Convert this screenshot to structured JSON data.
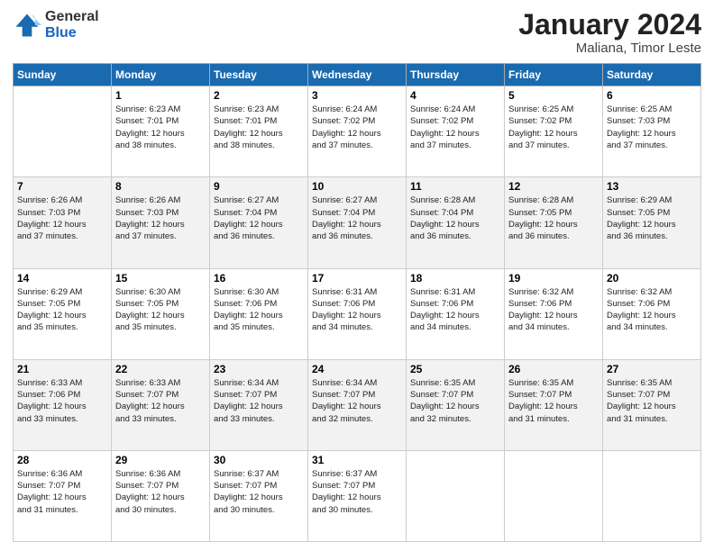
{
  "header": {
    "logo_general": "General",
    "logo_blue": "Blue",
    "main_title": "January 2024",
    "subtitle": "Maliana, Timor Leste"
  },
  "days_of_week": [
    "Sunday",
    "Monday",
    "Tuesday",
    "Wednesday",
    "Thursday",
    "Friday",
    "Saturday"
  ],
  "weeks": [
    {
      "bg": "white",
      "days": [
        {
          "num": "",
          "info": ""
        },
        {
          "num": "1",
          "info": "Sunrise: 6:23 AM\nSunset: 7:01 PM\nDaylight: 12 hours\nand 38 minutes."
        },
        {
          "num": "2",
          "info": "Sunrise: 6:23 AM\nSunset: 7:01 PM\nDaylight: 12 hours\nand 38 minutes."
        },
        {
          "num": "3",
          "info": "Sunrise: 6:24 AM\nSunset: 7:02 PM\nDaylight: 12 hours\nand 37 minutes."
        },
        {
          "num": "4",
          "info": "Sunrise: 6:24 AM\nSunset: 7:02 PM\nDaylight: 12 hours\nand 37 minutes."
        },
        {
          "num": "5",
          "info": "Sunrise: 6:25 AM\nSunset: 7:02 PM\nDaylight: 12 hours\nand 37 minutes."
        },
        {
          "num": "6",
          "info": "Sunrise: 6:25 AM\nSunset: 7:03 PM\nDaylight: 12 hours\nand 37 minutes."
        }
      ]
    },
    {
      "bg": "gray",
      "days": [
        {
          "num": "7",
          "info": "Sunrise: 6:26 AM\nSunset: 7:03 PM\nDaylight: 12 hours\nand 37 minutes."
        },
        {
          "num": "8",
          "info": "Sunrise: 6:26 AM\nSunset: 7:03 PM\nDaylight: 12 hours\nand 37 minutes."
        },
        {
          "num": "9",
          "info": "Sunrise: 6:27 AM\nSunset: 7:04 PM\nDaylight: 12 hours\nand 36 minutes."
        },
        {
          "num": "10",
          "info": "Sunrise: 6:27 AM\nSunset: 7:04 PM\nDaylight: 12 hours\nand 36 minutes."
        },
        {
          "num": "11",
          "info": "Sunrise: 6:28 AM\nSunset: 7:04 PM\nDaylight: 12 hours\nand 36 minutes."
        },
        {
          "num": "12",
          "info": "Sunrise: 6:28 AM\nSunset: 7:05 PM\nDaylight: 12 hours\nand 36 minutes."
        },
        {
          "num": "13",
          "info": "Sunrise: 6:29 AM\nSunset: 7:05 PM\nDaylight: 12 hours\nand 36 minutes."
        }
      ]
    },
    {
      "bg": "white",
      "days": [
        {
          "num": "14",
          "info": "Sunrise: 6:29 AM\nSunset: 7:05 PM\nDaylight: 12 hours\nand 35 minutes."
        },
        {
          "num": "15",
          "info": "Sunrise: 6:30 AM\nSunset: 7:05 PM\nDaylight: 12 hours\nand 35 minutes."
        },
        {
          "num": "16",
          "info": "Sunrise: 6:30 AM\nSunset: 7:06 PM\nDaylight: 12 hours\nand 35 minutes."
        },
        {
          "num": "17",
          "info": "Sunrise: 6:31 AM\nSunset: 7:06 PM\nDaylight: 12 hours\nand 34 minutes."
        },
        {
          "num": "18",
          "info": "Sunrise: 6:31 AM\nSunset: 7:06 PM\nDaylight: 12 hours\nand 34 minutes."
        },
        {
          "num": "19",
          "info": "Sunrise: 6:32 AM\nSunset: 7:06 PM\nDaylight: 12 hours\nand 34 minutes."
        },
        {
          "num": "20",
          "info": "Sunrise: 6:32 AM\nSunset: 7:06 PM\nDaylight: 12 hours\nand 34 minutes."
        }
      ]
    },
    {
      "bg": "gray",
      "days": [
        {
          "num": "21",
          "info": "Sunrise: 6:33 AM\nSunset: 7:06 PM\nDaylight: 12 hours\nand 33 minutes."
        },
        {
          "num": "22",
          "info": "Sunrise: 6:33 AM\nSunset: 7:07 PM\nDaylight: 12 hours\nand 33 minutes."
        },
        {
          "num": "23",
          "info": "Sunrise: 6:34 AM\nSunset: 7:07 PM\nDaylight: 12 hours\nand 33 minutes."
        },
        {
          "num": "24",
          "info": "Sunrise: 6:34 AM\nSunset: 7:07 PM\nDaylight: 12 hours\nand 32 minutes."
        },
        {
          "num": "25",
          "info": "Sunrise: 6:35 AM\nSunset: 7:07 PM\nDaylight: 12 hours\nand 32 minutes."
        },
        {
          "num": "26",
          "info": "Sunrise: 6:35 AM\nSunset: 7:07 PM\nDaylight: 12 hours\nand 31 minutes."
        },
        {
          "num": "27",
          "info": "Sunrise: 6:35 AM\nSunset: 7:07 PM\nDaylight: 12 hours\nand 31 minutes."
        }
      ]
    },
    {
      "bg": "white",
      "days": [
        {
          "num": "28",
          "info": "Sunrise: 6:36 AM\nSunset: 7:07 PM\nDaylight: 12 hours\nand 31 minutes."
        },
        {
          "num": "29",
          "info": "Sunrise: 6:36 AM\nSunset: 7:07 PM\nDaylight: 12 hours\nand 30 minutes."
        },
        {
          "num": "30",
          "info": "Sunrise: 6:37 AM\nSunset: 7:07 PM\nDaylight: 12 hours\nand 30 minutes."
        },
        {
          "num": "31",
          "info": "Sunrise: 6:37 AM\nSunset: 7:07 PM\nDaylight: 12 hours\nand 30 minutes."
        },
        {
          "num": "",
          "info": ""
        },
        {
          "num": "",
          "info": ""
        },
        {
          "num": "",
          "info": ""
        }
      ]
    }
  ]
}
